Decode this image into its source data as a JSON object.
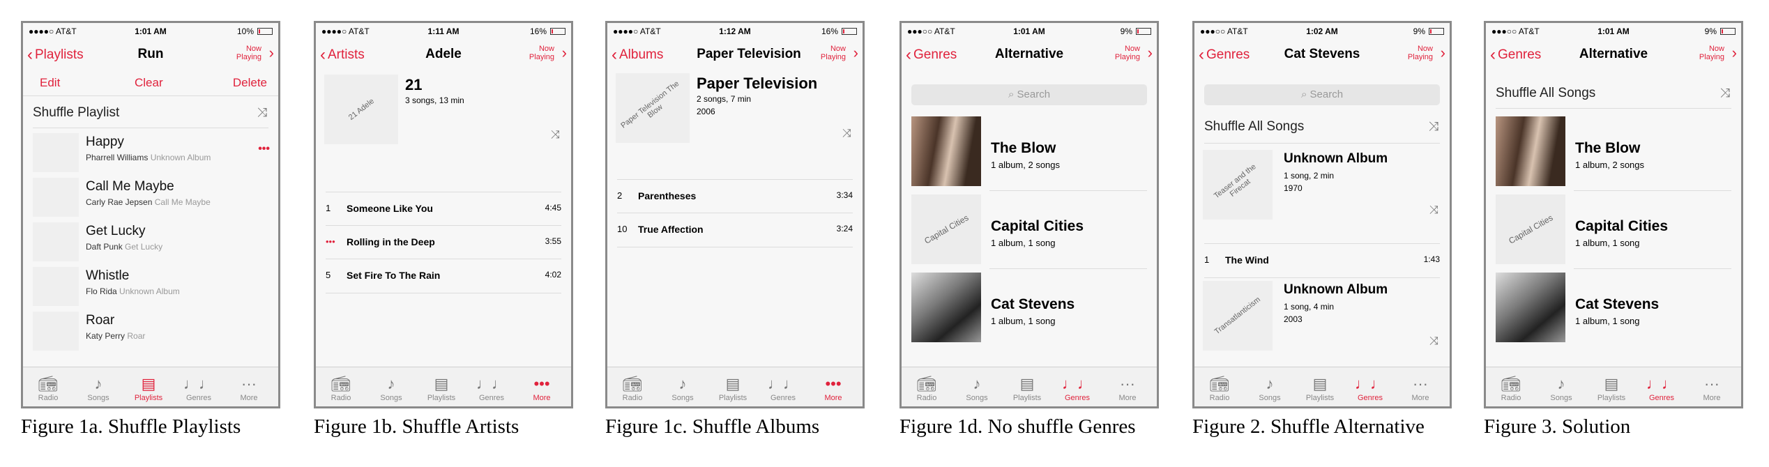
{
  "figures": [
    {
      "caption": "Figure 1a. Shuffle Playlists",
      "status": {
        "carrier": "●●●●○ AT&T",
        "time": "1:01 AM",
        "battery": "10%"
      },
      "nav": {
        "back": "Playlists",
        "title": "Run",
        "now_playing_1": "Now",
        "now_playing_2": "Playing"
      },
      "edit": {
        "edit": "Edit",
        "clear": "Clear",
        "delete": "Delete"
      },
      "shuffle_label": "Shuffle Playlist",
      "songs": [
        {
          "title": "Happy",
          "artist": "Pharrell Williams",
          "album": "Unknown Album"
        },
        {
          "title": "Call Me Maybe",
          "artist": "Carly Rae Jepsen",
          "album": "Call Me Maybe"
        },
        {
          "title": "Get Lucky",
          "artist": "Daft Punk",
          "album": "Get Lucky"
        },
        {
          "title": "Whistle",
          "artist": "Flo Rida",
          "album": "Unknown Album"
        },
        {
          "title": "Roar",
          "artist": "Katy Perry",
          "album": "Roar"
        }
      ],
      "tabs": [
        "Radio",
        "Songs",
        "Playlists",
        "Genres",
        "More"
      ],
      "active_tab": "Playlists"
    },
    {
      "caption": "Figure 1b. Shuffle Artists",
      "status": {
        "carrier": "●●●●○ AT&T",
        "time": "1:11 AM",
        "battery": "16%"
      },
      "nav": {
        "back": "Artists",
        "title": "Adele",
        "now_playing_1": "Now",
        "now_playing_2": "Playing"
      },
      "album": {
        "art_text": "21 Adele",
        "title": "21",
        "songs": "3 songs, 13 min",
        "year": ""
      },
      "tracks": [
        {
          "no": "1",
          "title": "Someone Like You",
          "time": "4:45"
        },
        {
          "no": "•••",
          "title": "Rolling in the Deep",
          "time": "3:55"
        },
        {
          "no": "5",
          "title": "Set Fire To The Rain",
          "time": "4:02"
        }
      ],
      "tabs": [
        "Radio",
        "Songs",
        "Playlists",
        "Genres",
        "More"
      ],
      "active_tab": "More"
    },
    {
      "caption": "Figure 1c. Shuffle Albums",
      "status": {
        "carrier": "●●●●○ AT&T",
        "time": "1:12 AM",
        "battery": "16%"
      },
      "nav": {
        "back": "Albums",
        "title": "Paper Television",
        "now_playing_1": "Now",
        "now_playing_2": "Playing"
      },
      "album": {
        "art_text": "Paper Television The Blow",
        "title": "Paper Television",
        "songs": "2 songs, 7 min",
        "year": "2006"
      },
      "tracks": [
        {
          "no": "2",
          "title": "Parentheses",
          "time": "3:34"
        },
        {
          "no": "10",
          "title": "True Affection",
          "time": "3:24"
        }
      ],
      "tabs": [
        "Radio",
        "Songs",
        "Playlists",
        "Genres",
        "More"
      ],
      "active_tab": "More"
    },
    {
      "caption": "Figure 1d. No shuffle Genres",
      "status": {
        "carrier": "●●●○○ AT&T",
        "time": "1:01 AM",
        "battery": "9%"
      },
      "nav": {
        "back": "Genres",
        "title": "Alternative",
        "now_playing_1": "Now",
        "now_playing_2": "Playing"
      },
      "search": "Search",
      "artists": [
        {
          "name": "The Blow",
          "sub": "1 album, 2 songs",
          "art": ""
        },
        {
          "name": "Capital Cities",
          "sub": "1 album, 1 song",
          "art": "Capital Cities"
        },
        {
          "name": "Cat Stevens",
          "sub": "1 album, 1 song",
          "art": ""
        }
      ],
      "tabs": [
        "Radio",
        "Songs",
        "Playlists",
        "Genres",
        "More"
      ],
      "active_tab": "Genres"
    },
    {
      "caption": "Figure 2. Shuffle Alternative",
      "status": {
        "carrier": "●●●○○ AT&T",
        "time": "1:02 AM",
        "battery": "9%"
      },
      "nav": {
        "back": "Genres",
        "title": "Cat Stevens",
        "now_playing_1": "Now",
        "now_playing_2": "Playing"
      },
      "search": "Search",
      "shuffle_label": "Shuffle All Songs",
      "albums": [
        {
          "art": "Teaser and the Firecat",
          "title": "Unknown Album",
          "sub": "1 song, 2 min",
          "year": "1970"
        },
        {
          "art": "Transatlanticism",
          "title": "Unknown Album",
          "sub": "1 song, 4 min",
          "year": "2003"
        }
      ],
      "track": {
        "no": "1",
        "title": "The Wind",
        "time": "1:43"
      },
      "tabs": [
        "Radio",
        "Songs",
        "Playlists",
        "Genres",
        "More"
      ],
      "active_tab": "Genres"
    },
    {
      "caption": "Figure 3. Solution",
      "status": {
        "carrier": "●●●○○ AT&T",
        "time": "1:01 AM",
        "battery": "9%"
      },
      "nav": {
        "back": "Genres",
        "title": "Alternative",
        "now_playing_1": "Now",
        "now_playing_2": "Playing"
      },
      "shuffle_label": "Shuffle All Songs",
      "artists": [
        {
          "name": "The Blow",
          "sub": "1 album, 2 songs",
          "art": ""
        },
        {
          "name": "Capital Cities",
          "sub": "1 album, 1 song",
          "art": "Capital Cities"
        },
        {
          "name": "Cat Stevens",
          "sub": "1 album, 1 song",
          "art": ""
        }
      ],
      "tabs": [
        "Radio",
        "Songs",
        "Playlists",
        "Genres",
        "More"
      ],
      "active_tab": "Genres"
    }
  ],
  "colors": {
    "accent": "#e0223c",
    "background": "#f7f7f7"
  },
  "icons": {
    "back": "chevron-left-icon",
    "shuffle": "shuffle-icon",
    "tabs": [
      "radio-icon",
      "music-note-icon",
      "playlist-icon",
      "guitar-icon",
      "more-dots-icon"
    ]
  }
}
